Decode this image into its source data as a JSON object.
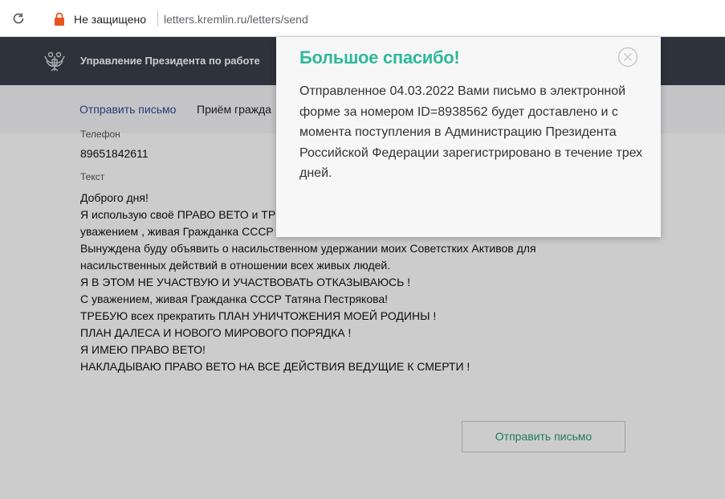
{
  "browser": {
    "security_label": "Не защищено",
    "url": "letters.kremlin.ru/letters/send",
    "icons": [
      "reload-icon",
      "lock-icon"
    ]
  },
  "site": {
    "title": "Управление Президента по работе",
    "nav": {
      "send": "Отправить письмо",
      "receive": "Приём гражда"
    }
  },
  "form": {
    "phone_label": "Телефон",
    "phone_value": "89651842611",
    "text_label": "Текст",
    "text_lines": [
      "Доброго дня!",
      "Я использую своё ПРАВО ВЕТО и ТРЕ",
      "уважением , живая Гражданка СССР",
      "Вынуждена буду объявить о насильственном удержании моих Советстких Активов для",
      "насильственных действий в отношении всех живых людей.",
      "Я В ЭТОМ НЕ УЧАСТВУЮ И УЧАСТВОВАТЬ ОТКАЗЫВАЮСЬ !",
      "С уважением, живая Гражданка СССР Татяна Пестрякова!",
      "ТРЕБУЮ всех прекратить ПЛАН УНИЧТОЖЕНИЯ МОЕЙ РОДИНЫ !",
      "ПЛАН ДАЛЕСА И НОВОГО МИРОВОГО ПОРЯДКА !",
      "Я ИМЕЮ ПРАВО ВЕТО!",
      "НАКЛАДЫВАЮ ПРАВО ВЕТО НА ВСЕ ДЕЙСТВИЯ ВЕДУЩИЕ К СМЕРТИ !"
    ],
    "submit_label": "Отправить письмо"
  },
  "modal": {
    "title": "Большое спасибо!",
    "body": "Отправленное 04.03.2022 Вами письмо в электронной форме за номером ID=8938562 будет доставлено и с момента поступления в Администрацию Президента Российской Федерации зарегистрировано в течение трех дней.",
    "close_icon": "close-icon"
  },
  "colors": {
    "accent": "#2fb89a",
    "header": "#3a3f4a",
    "link": "#2c4a9a"
  }
}
